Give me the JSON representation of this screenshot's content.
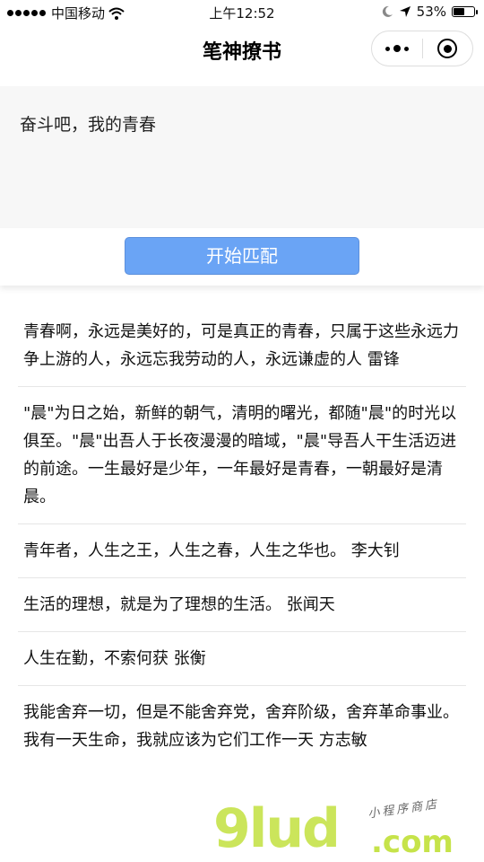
{
  "status_bar": {
    "carrier": "中国移动",
    "time": "上午12:52",
    "battery_text": "53%",
    "battery_level": 0.53
  },
  "nav": {
    "title": "笔神撩书"
  },
  "input": {
    "value": "奋斗吧，我的青春"
  },
  "match_button": {
    "label": "开始匹配",
    "color": "#6aa4f5"
  },
  "quotes": [
    "青春啊，永远是美好的，可是真正的青春，只属于这些永远力争上游的人，永远忘我劳动的人，永远谦虚的人 雷锋",
    "\"晨\"为日之始，新鲜的朝气，清明的曙光，都随\"晨\"的时光以俱至。\"晨\"出吾人于长夜漫漫的暗域，\"晨\"导吾人干生活迈进的前途。一生最好是少年，一年最好是青春，一朝最好是清晨。",
    "青年者，人生之王，人生之春，人生之华也。 李大钊",
    "生活的理想，就是为了理想的生活。 张闻天",
    "人生在勤，不索何获 张衡",
    "我能舍弃一切，但是不能舍弃党，舍弃阶级，舍弃革命事业。我有一天生命，我就应该为它们工作一天 方志敏"
  ],
  "watermark": {
    "logo": "9lud",
    "sub": "小程序商店",
    "com": ".com"
  }
}
